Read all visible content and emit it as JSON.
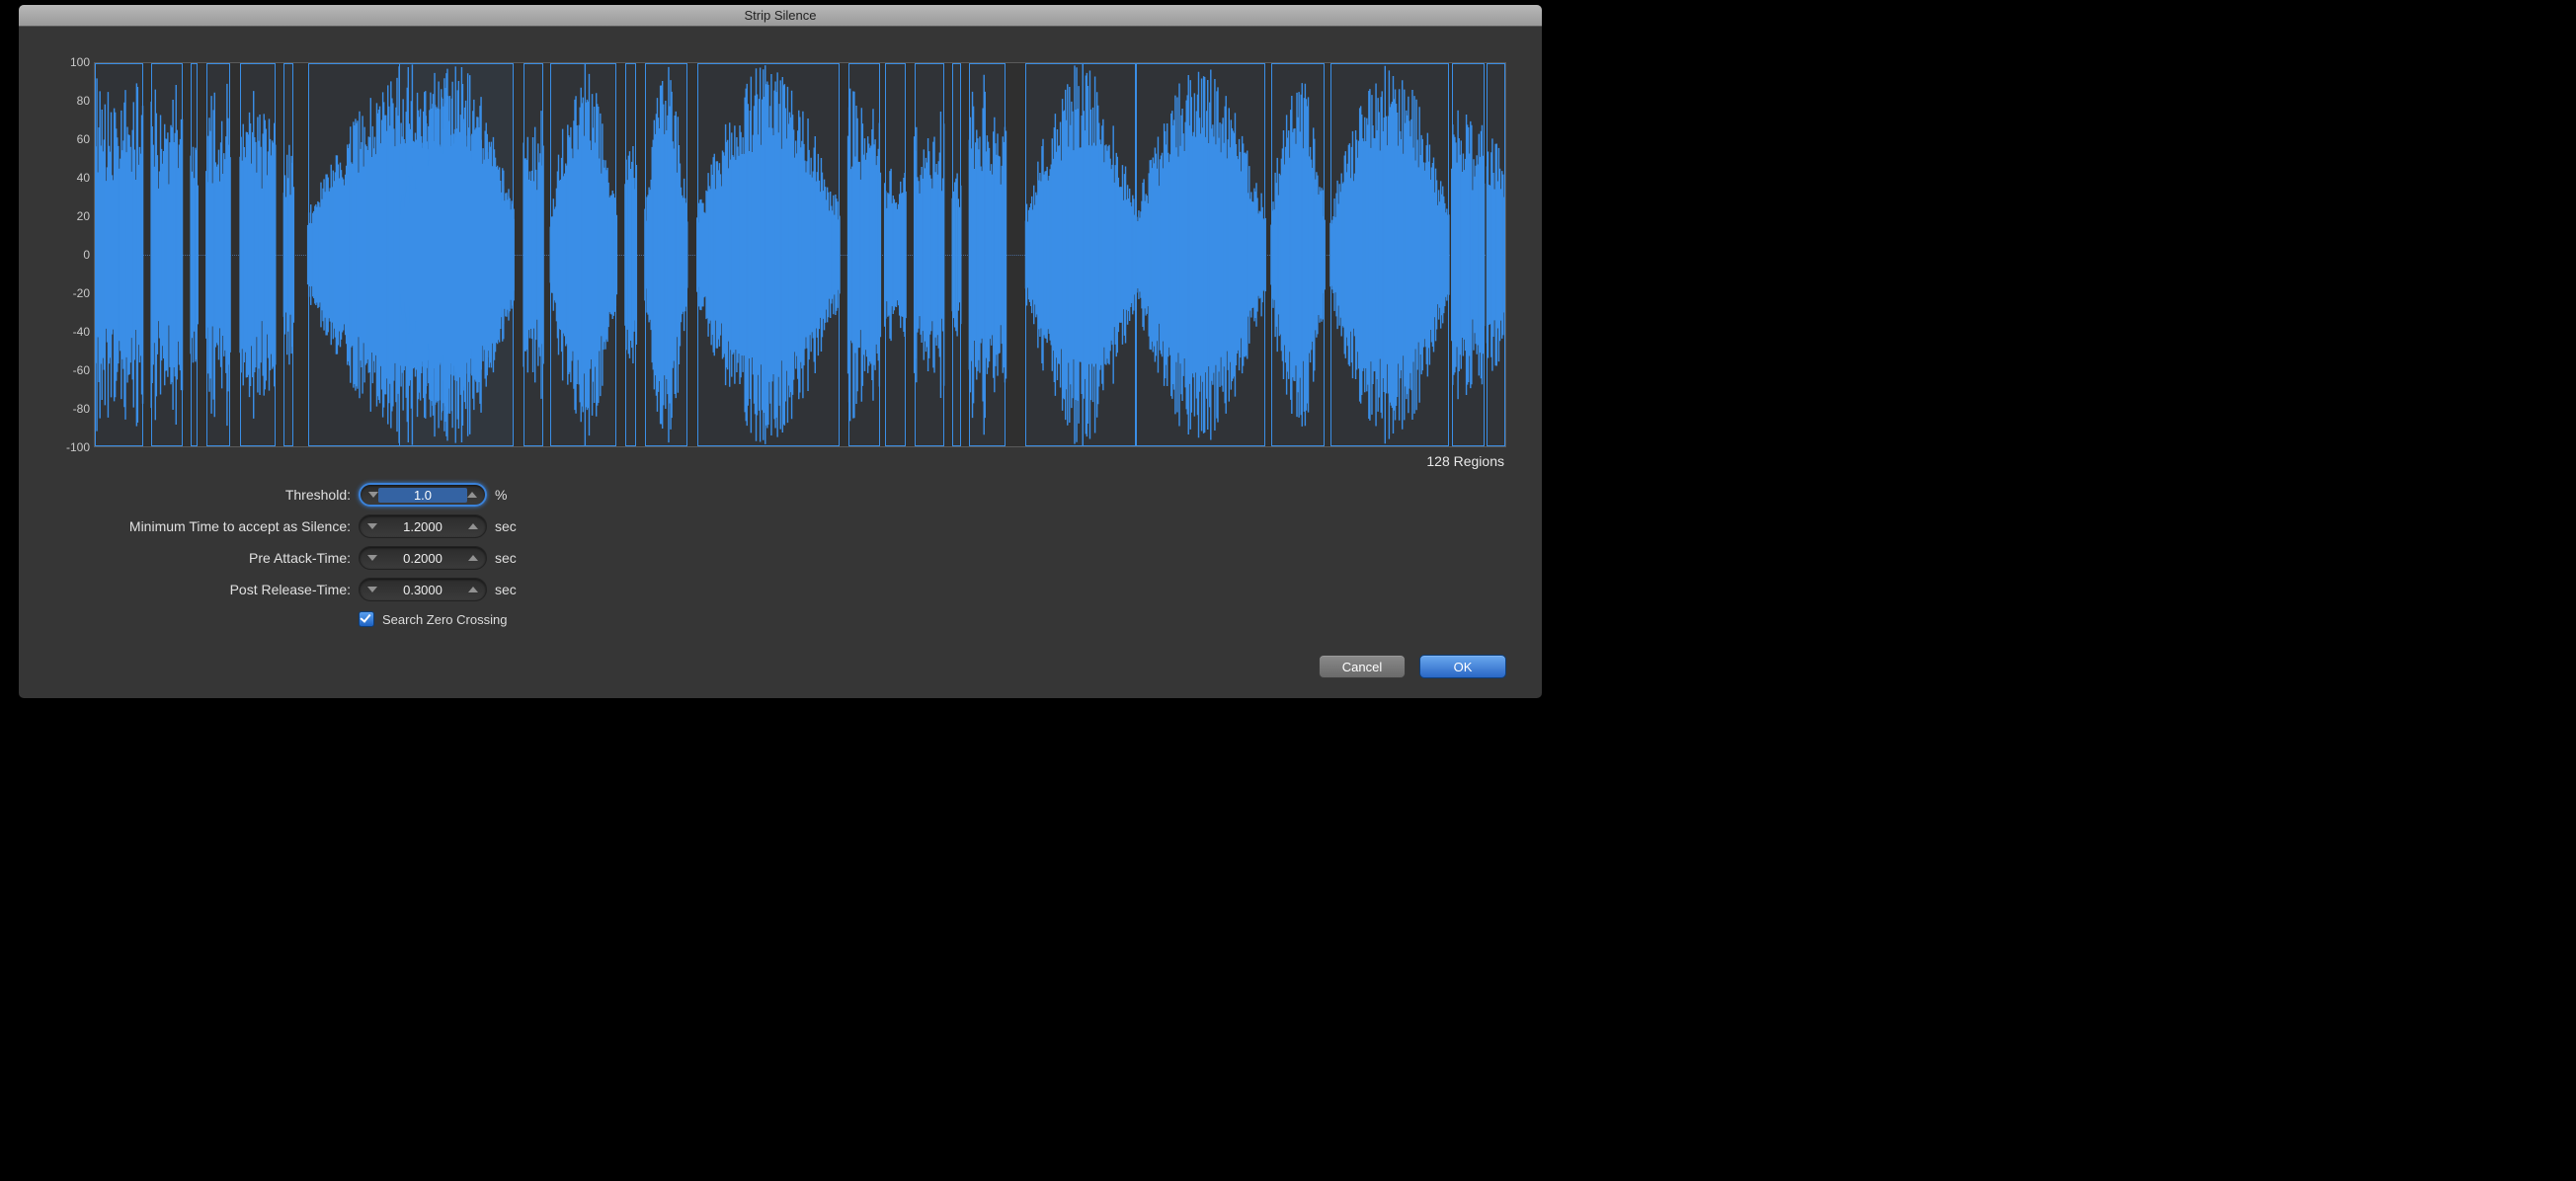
{
  "title": "Strip Silence",
  "yaxis": [
    "100",
    "80",
    "60",
    "40",
    "20",
    "0",
    "-20",
    "-40",
    "-60",
    "-80",
    "-100"
  ],
  "regions_label": "128 Regions",
  "params": {
    "threshold": {
      "label": "Threshold:",
      "value": "1.0",
      "unit": "%"
    },
    "min_silence": {
      "label": "Minimum Time to accept as Silence:",
      "value": "1.2000",
      "unit": "sec"
    },
    "pre_attack": {
      "label": "Pre Attack-Time:",
      "value": "0.2000",
      "unit": "sec"
    },
    "post_release": {
      "label": "Post Release-Time:",
      "value": "0.3000",
      "unit": "sec"
    }
  },
  "checkbox": {
    "label": "Search Zero Crossing",
    "checked": true
  },
  "buttons": {
    "cancel": "Cancel",
    "ok": "OK"
  },
  "chart_data": {
    "type": "area",
    "title": "",
    "xlabel": "",
    "ylabel": "",
    "ylim": [
      -100,
      100
    ],
    "segments": [
      {
        "start": 0.0,
        "end": 0.034,
        "amp": 100
      },
      {
        "start": 0.04,
        "end": 0.062,
        "amp": 100
      },
      {
        "start": 0.068,
        "end": 0.073,
        "amp": 100
      },
      {
        "start": 0.079,
        "end": 0.096,
        "amp": 100
      },
      {
        "start": 0.103,
        "end": 0.128,
        "amp": 100
      },
      {
        "start": 0.134,
        "end": 0.141,
        "amp": 65
      },
      {
        "start": 0.151,
        "end": 0.297,
        "amp": 100,
        "shape": "bell"
      },
      {
        "start": 0.216,
        "end": 0.297,
        "amp": 100,
        "shape": "bell"
      },
      {
        "start": 0.304,
        "end": 0.318,
        "amp": 88
      },
      {
        "start": 0.323,
        "end": 0.37,
        "amp": 100,
        "shape": "bell"
      },
      {
        "start": 0.376,
        "end": 0.384,
        "amp": 72
      },
      {
        "start": 0.39,
        "end": 0.42,
        "amp": 100,
        "shape": "bell"
      },
      {
        "start": 0.427,
        "end": 0.528,
        "amp": 100,
        "shape": "bell"
      },
      {
        "start": 0.534,
        "end": 0.557,
        "amp": 95
      },
      {
        "start": 0.56,
        "end": 0.575,
        "amp": 55
      },
      {
        "start": 0.581,
        "end": 0.602,
        "amp": 82
      },
      {
        "start": 0.608,
        "end": 0.614,
        "amp": 60
      },
      {
        "start": 0.62,
        "end": 0.646,
        "amp": 100
      },
      {
        "start": 0.66,
        "end": 0.738,
        "amp": 100,
        "shape": "bell"
      },
      {
        "start": 0.738,
        "end": 0.83,
        "amp": 100,
        "shape": "bell"
      },
      {
        "start": 0.834,
        "end": 0.872,
        "amp": 100,
        "shape": "bell"
      },
      {
        "start": 0.876,
        "end": 0.96,
        "amp": 100,
        "shape": "bell"
      },
      {
        "start": 0.962,
        "end": 0.985,
        "amp": 92
      },
      {
        "start": 0.987,
        "end": 1.0,
        "amp": 78
      }
    ]
  }
}
